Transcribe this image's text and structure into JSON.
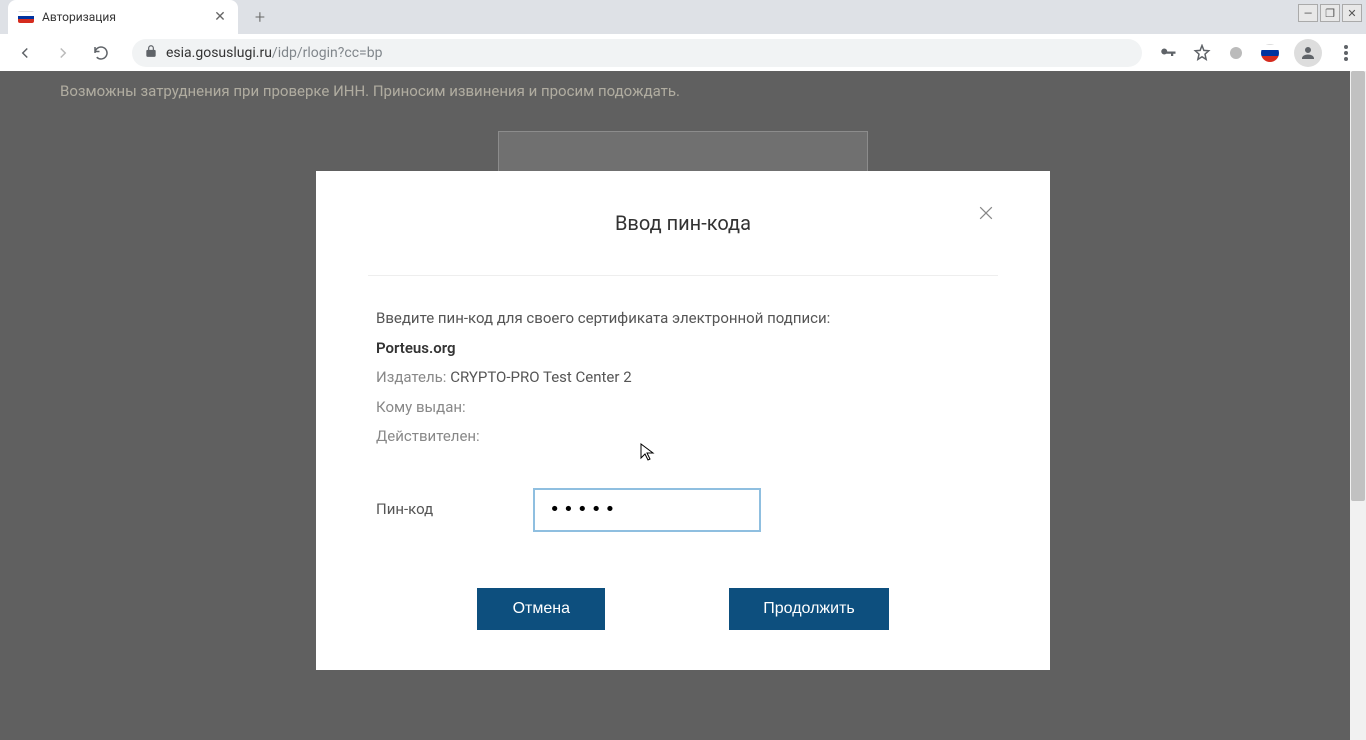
{
  "browser": {
    "tab_title": "Авторизация",
    "url_host": "esia.gosuslugi.ru",
    "url_path": "/idp/rlogin?cc=bp"
  },
  "page": {
    "warning_text": "Возможны затруднения при проверке ИНН. Приносим извинения и просим подождать."
  },
  "modal": {
    "title": "Ввод пин-кода",
    "instruction": "Введите пин-код для своего сертификата электронной подписи:",
    "cert_name": "Porteus.org",
    "issuer_label": "Издатель:",
    "issuer_value": "CRYPTO-PRO Test Center 2",
    "issued_to_label": "Кому выдан:",
    "issued_to_value": "",
    "valid_label": "Действителен:",
    "valid_value": "",
    "pin_label": "Пин-код",
    "pin_value": "•••••",
    "cancel": "Отмена",
    "continue": "Продолжить"
  }
}
